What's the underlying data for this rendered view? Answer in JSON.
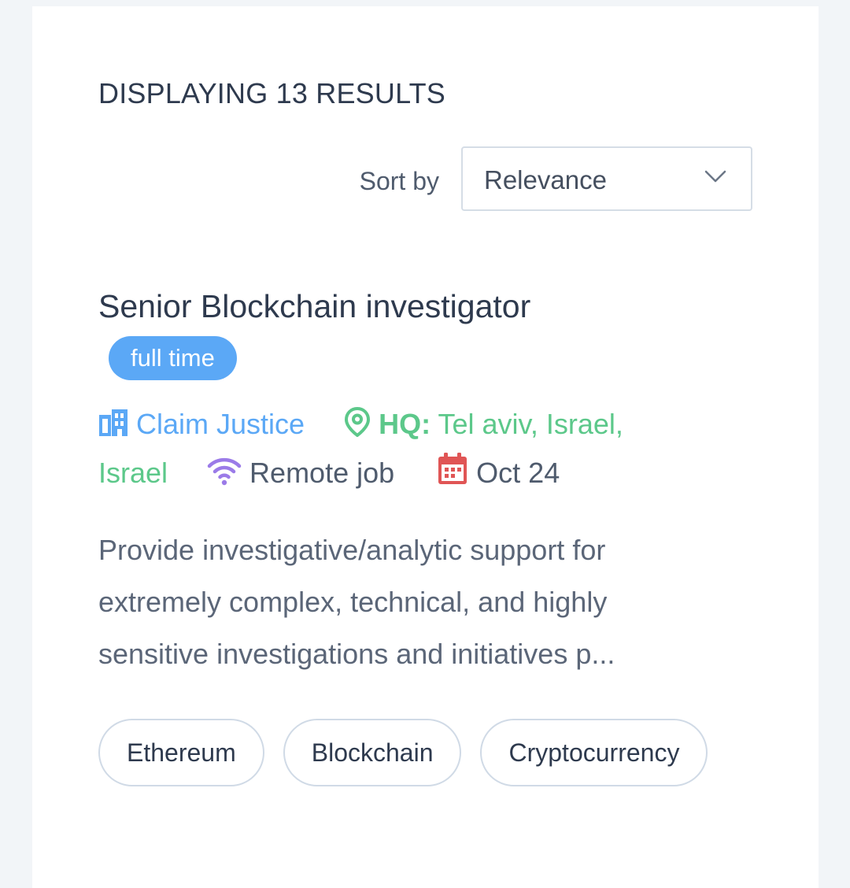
{
  "results": {
    "heading": "DISPLAYING 13 RESULTS"
  },
  "sort": {
    "label": "Sort by",
    "selected": "Relevance",
    "icon": "chevron-down-icon"
  },
  "job": {
    "title": "Senior Blockchain investigator",
    "type": "full time",
    "company": "Claim Justice",
    "location_prefix": "HQ:",
    "location": "Tel aviv, Israel, Israel",
    "remote": "Remote job",
    "date": "Oct 24",
    "description": "Provide investigative/analytic support for extremely complex, technical, and highly sensitive investigations and initiatives p...",
    "tags": [
      "Ethereum",
      "Blockchain",
      "Cryptocurrency"
    ],
    "icons": {
      "company": "building-icon",
      "location": "map-pin-icon",
      "remote": "wifi-icon",
      "date": "calendar-icon"
    }
  },
  "colors": {
    "background": "#f2f5f8",
    "card": "#ffffff",
    "heading_text": "#2e3a4e",
    "body_text": "#5b6678",
    "badge": "#5ba8f6",
    "company": "#5ba8f6",
    "location": "#5cc88a",
    "remote_icon": "#9b7be8",
    "date_icon": "#e05555",
    "border": "#d0dae6"
  }
}
